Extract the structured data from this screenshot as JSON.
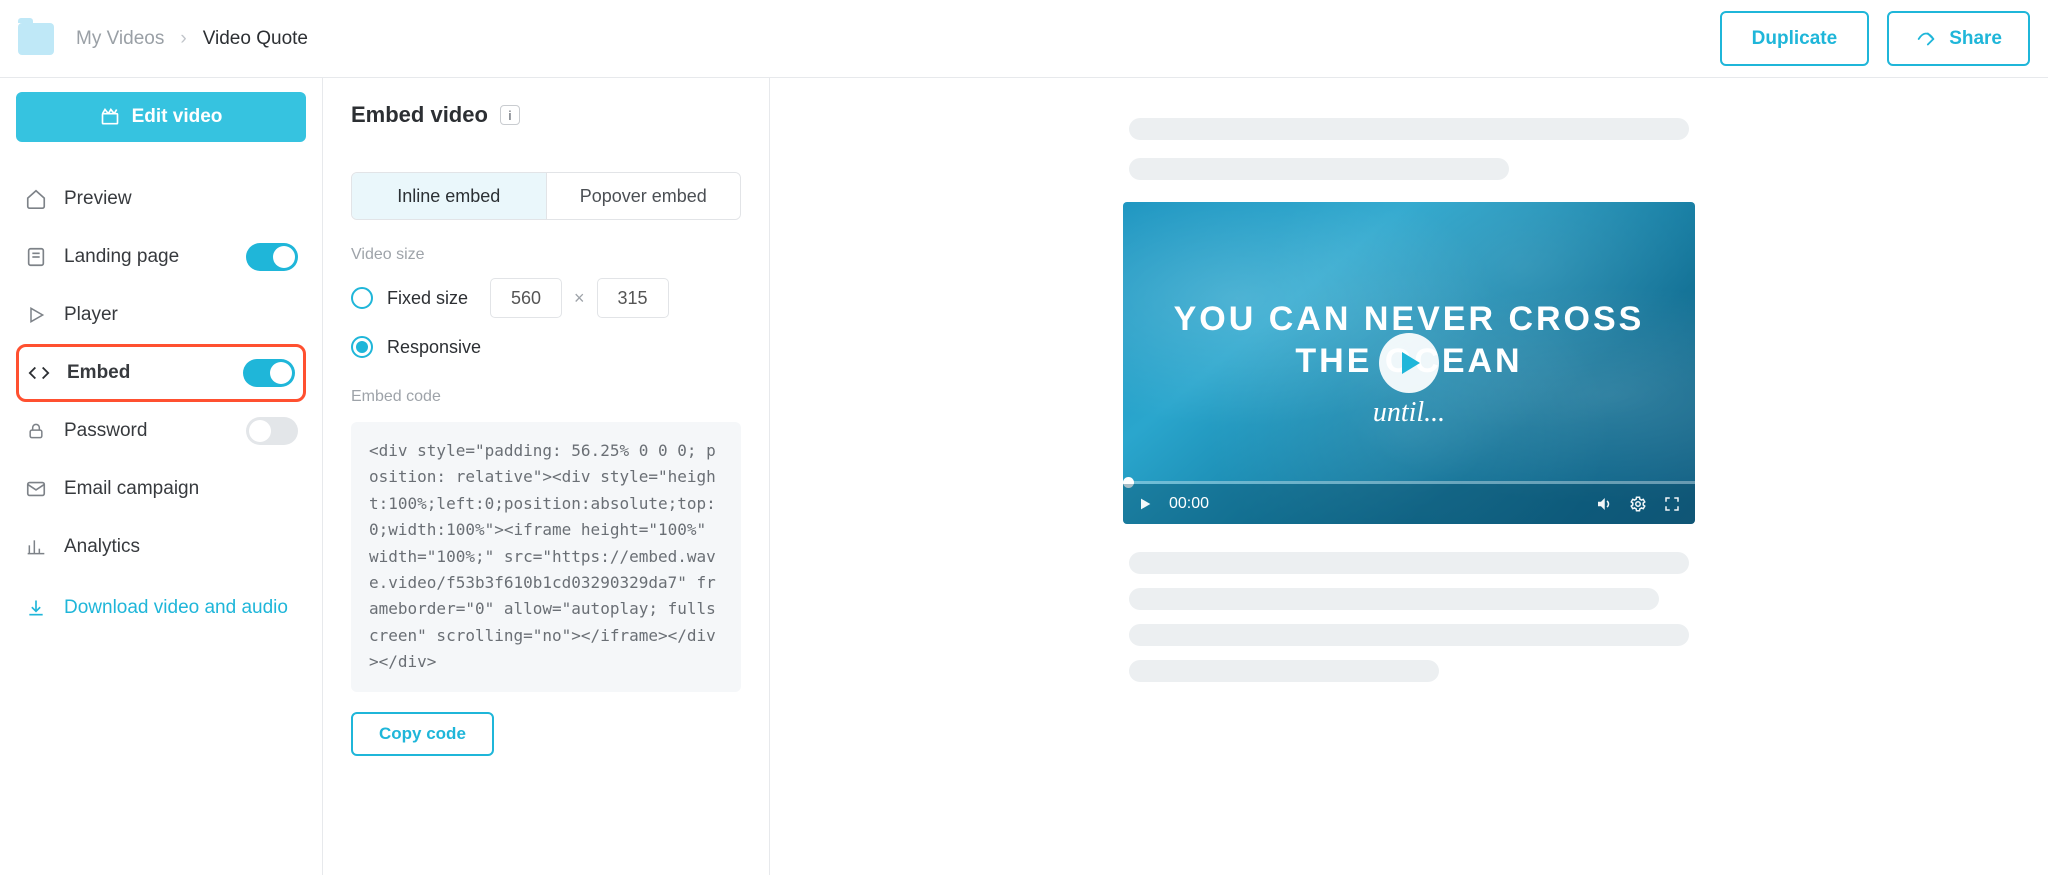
{
  "breadcrumb": {
    "parent": "My Videos",
    "current": "Video Quote"
  },
  "top_actions": {
    "duplicate": "Duplicate",
    "share": "Share"
  },
  "sidebar": {
    "edit_button": "Edit video",
    "items": [
      {
        "label": "Preview",
        "icon": "home",
        "toggle": null
      },
      {
        "label": "Landing page",
        "icon": "page",
        "toggle": true
      },
      {
        "label": "Player",
        "icon": "play",
        "toggle": null
      },
      {
        "label": "Embed",
        "icon": "code",
        "toggle": true,
        "highlighted": true
      },
      {
        "label": "Password",
        "icon": "lock",
        "toggle": false
      },
      {
        "label": "Email campaign",
        "icon": "mail",
        "toggle": null
      },
      {
        "label": "Analytics",
        "icon": "chart",
        "toggle": null
      }
    ],
    "download_link": "Download video and audio"
  },
  "embed_panel": {
    "title": "Embed video",
    "tabs": {
      "inline": "Inline embed",
      "popover": "Popover embed",
      "active": "inline"
    },
    "video_size_label": "Video size",
    "fixed_label": "Fixed size",
    "responsive_label": "Responsive",
    "size_selected": "responsive",
    "width": "560",
    "height": "315",
    "embed_code_label": "Embed code",
    "embed_code": "<div style=\"padding: 56.25% 0 0 0; position: relative\"><div style=\"height:100%;left:0;position:absolute;top:0;width:100%\"><iframe height=\"100%\" width=\"100%;\" src=\"https://embed.wave.video/f53b3f610b1cd03290329da7\" frameborder=\"0\" allow=\"autoplay; fullscreen\" scrolling=\"no\"></iframe></div></div>",
    "copy_button": "Copy code"
  },
  "preview": {
    "headline_line1": "YOU CAN NEVER CROSS",
    "headline_line2": "THE OCEAN",
    "subline": "until...",
    "time": "00:00"
  }
}
